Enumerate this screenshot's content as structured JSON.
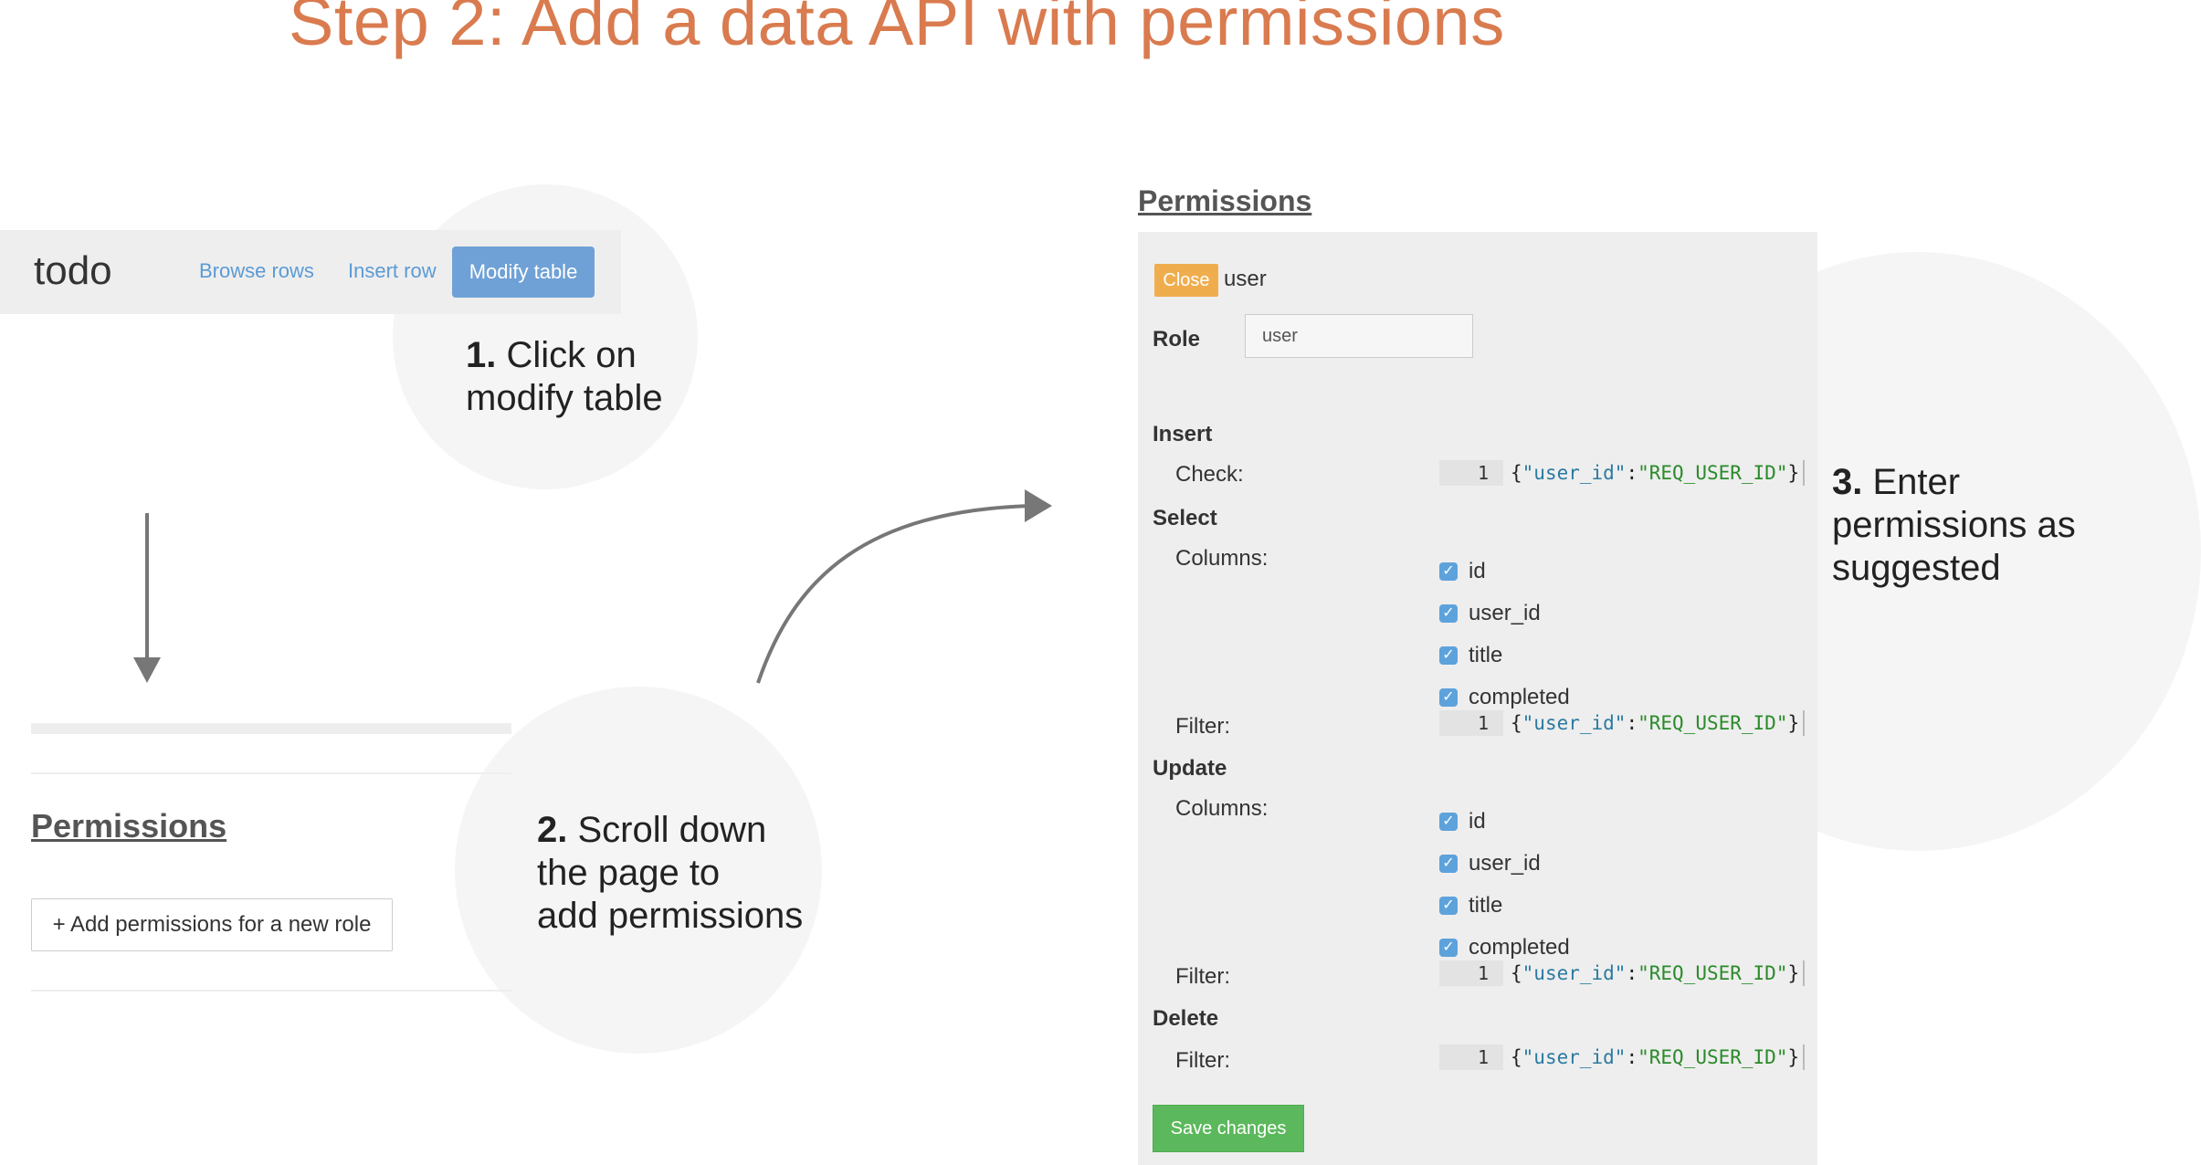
{
  "title": "Step 2: Add a data API with permissions",
  "left_panel": {
    "brand": "todo",
    "nav": [
      "Browse rows",
      "Insert row",
      "Modify table"
    ],
    "permissions_heading": "Permissions",
    "add_button": "+ Add permissions for a new role"
  },
  "steps": [
    {
      "num": "1.",
      "text_lines": [
        "Click on",
        "modify table"
      ]
    },
    {
      "num": "2.",
      "text_lines": [
        "Scroll down",
        "the page to",
        "add permissions"
      ]
    },
    {
      "num": "3.",
      "text_lines": [
        "Enter",
        "permissions as",
        "suggested"
      ]
    }
  ],
  "right_panel": {
    "heading": "Permissions",
    "close": "Close",
    "role_name": "user",
    "role_label": "Role",
    "role_value": "user",
    "insert": {
      "label": "Insert",
      "check_label": "Check:"
    },
    "select": {
      "label": "Select",
      "columns_label": "Columns:",
      "filter_label": "Filter:"
    },
    "update": {
      "label": "Update",
      "columns_label": "Columns:",
      "filter_label": "Filter:"
    },
    "delete": {
      "label": "Delete",
      "filter_label": "Filter:"
    },
    "columns": [
      "id",
      "user_id",
      "title",
      "completed"
    ],
    "code": {
      "line": "1",
      "open": "{",
      "key": "\"user_id\"",
      "colon": ":",
      "value": "\"REQ_USER_ID\"",
      "close": "}"
    },
    "save": "Save changes"
  },
  "colors": {
    "title": "#d97b4f",
    "modify_button": "#6fa1d6",
    "close_button": "#f0ad4e",
    "save_button": "#5cb85c",
    "checkbox": "#5ea2db"
  },
  "icons": [
    "arrow-down-icon",
    "curved-arrow-icon",
    "checkbox-checked-icon"
  ]
}
